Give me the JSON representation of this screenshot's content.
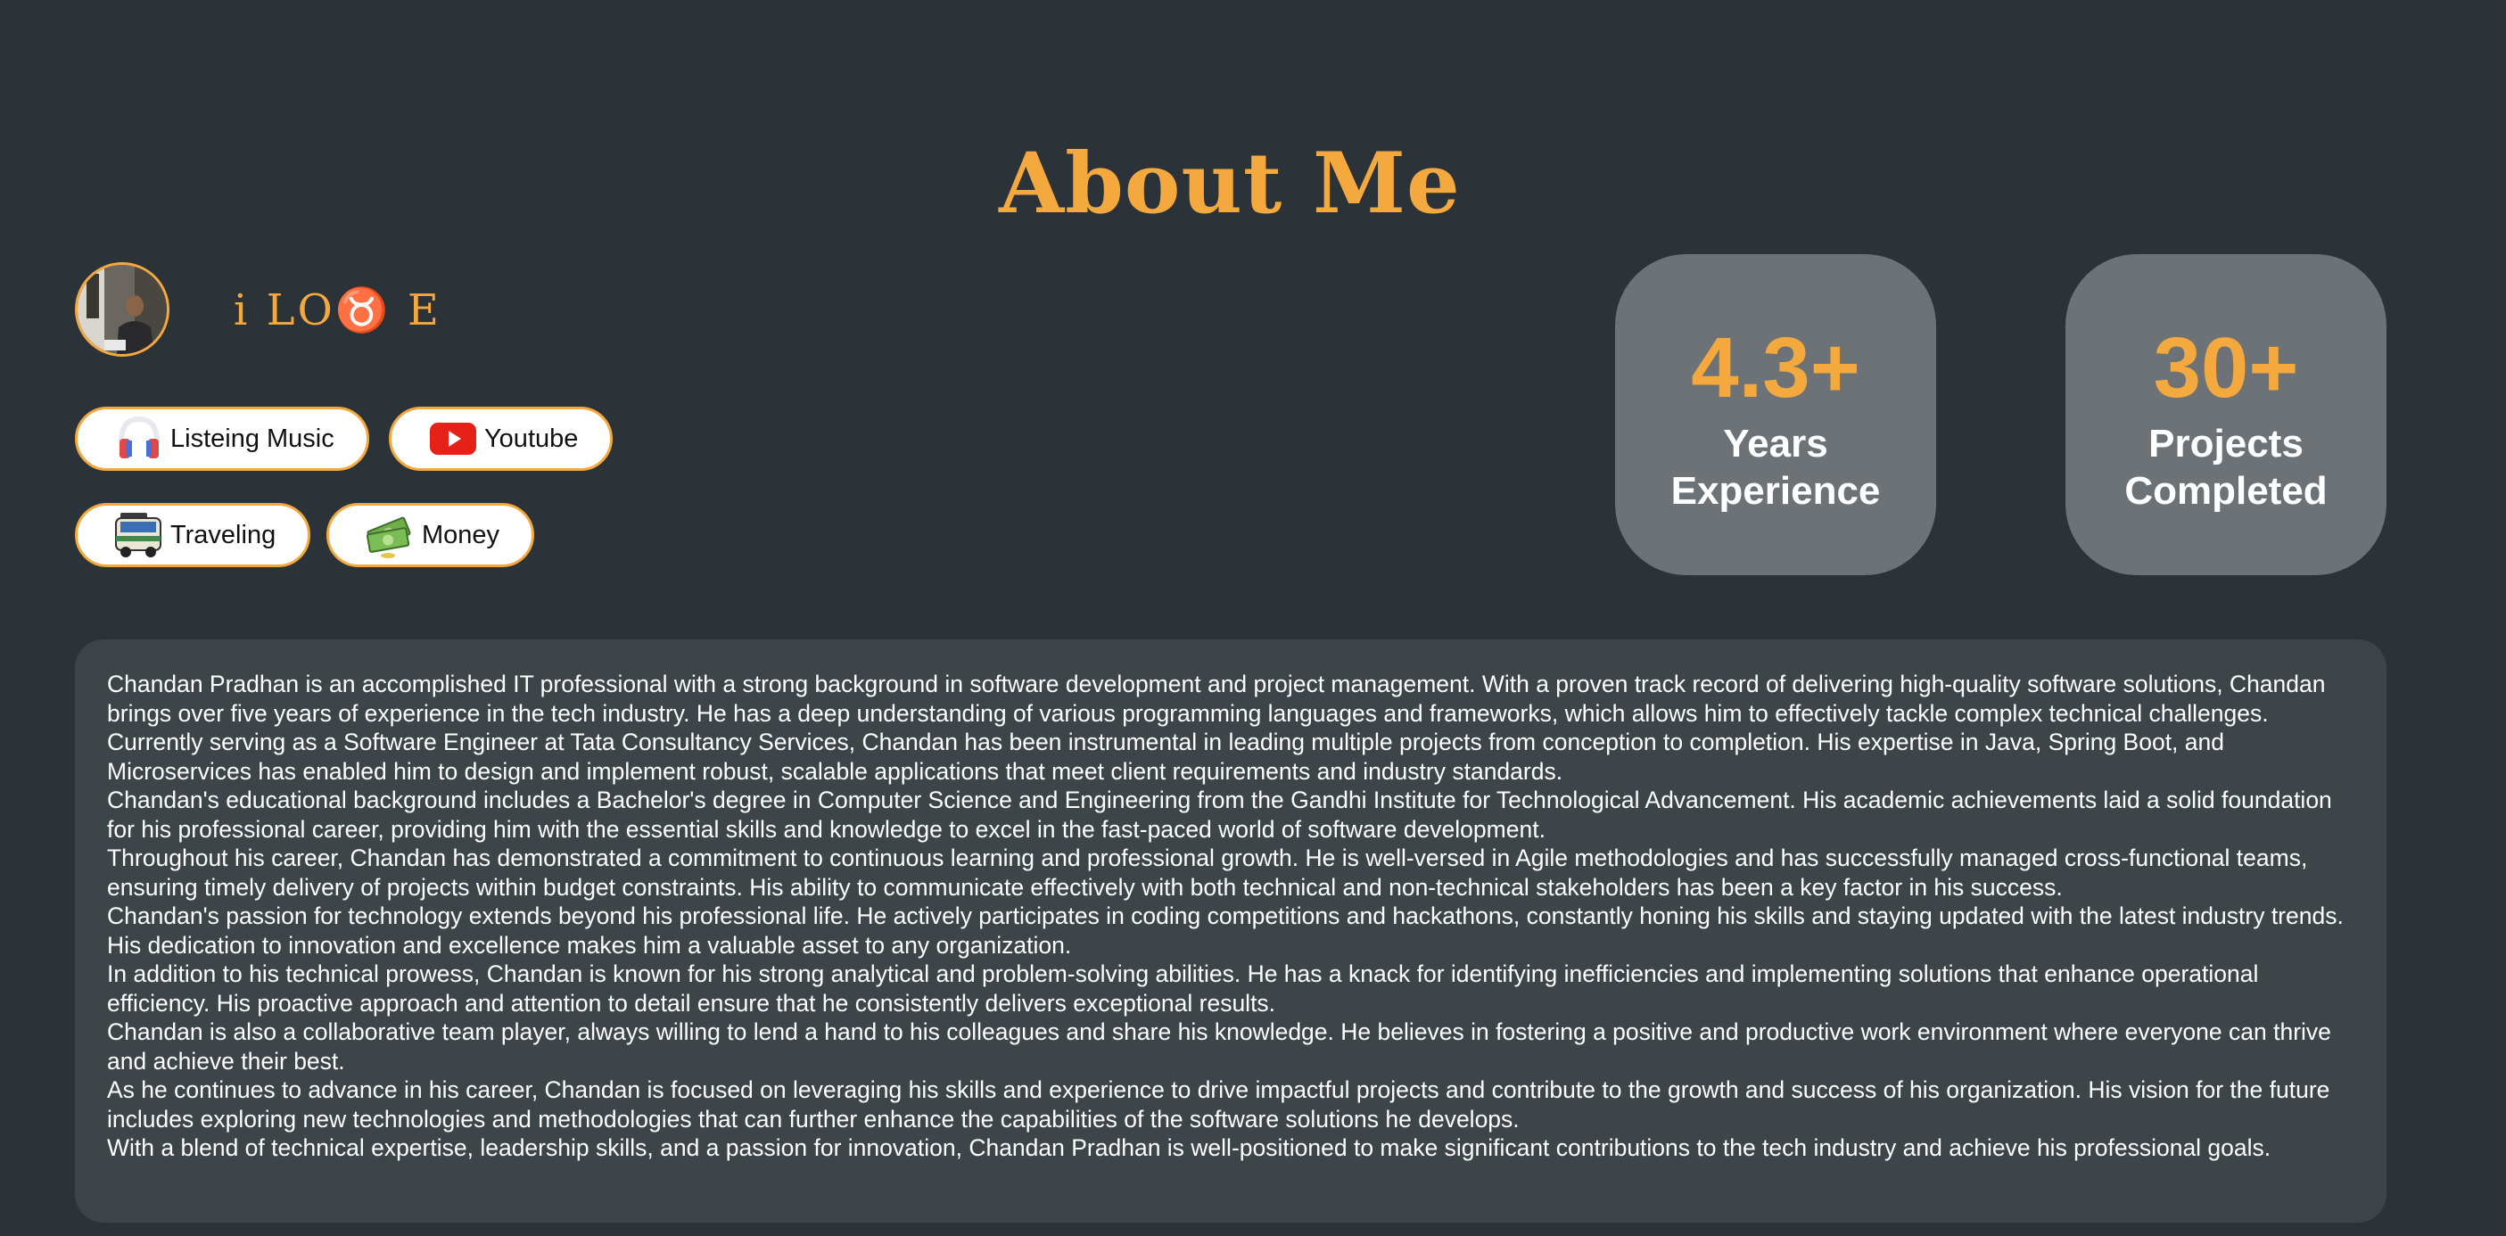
{
  "page": {
    "title": "About Me"
  },
  "profile": {
    "love_heading": "i LO♉ E"
  },
  "interests": [
    {
      "label": "Listeing Music",
      "icon": "headphones-icon"
    },
    {
      "label": "Youtube",
      "icon": "youtube-icon"
    },
    {
      "label": "Traveling",
      "icon": "bus-icon"
    },
    {
      "label": "Money",
      "icon": "money-icon"
    }
  ],
  "stats": [
    {
      "value": "4.3+",
      "label": "Years Experience"
    },
    {
      "value": "30+",
      "label": "Projects Completed"
    }
  ],
  "bio": {
    "paragraphs": [
      "Chandan Pradhan is an accomplished IT professional with a strong background in software development and project management. With a proven track record of delivering high-quality software solutions, Chandan brings over five years of experience in the tech industry. He has a deep understanding of various programming languages and frameworks, which allows him to effectively tackle complex technical challenges.",
      "Currently serving as a Software Engineer at Tata Consultancy Services, Chandan has been instrumental in leading multiple projects from conception to completion. His expertise in Java, Spring Boot, and Microservices has enabled him to design and implement robust, scalable applications that meet client requirements and industry standards.",
      "Chandan's educational background includes a Bachelor's degree in Computer Science and Engineering from the Gandhi Institute for Technological Advancement. His academic achievements laid a solid foundation for his professional career, providing him with the essential skills and knowledge to excel in the fast-paced world of software development.",
      "Throughout his career, Chandan has demonstrated a commitment to continuous learning and professional growth. He is well-versed in Agile methodologies and has successfully managed cross-functional teams, ensuring timely delivery of projects within budget constraints. His ability to communicate effectively with both technical and non-technical stakeholders has been a key factor in his success.",
      "Chandan's passion for technology extends beyond his professional life. He actively participates in coding competitions and hackathons, constantly honing his skills and staying updated with the latest industry trends. His dedication to innovation and excellence makes him a valuable asset to any organization.",
      "In addition to his technical prowess, Chandan is known for his strong analytical and problem-solving abilities. He has a knack for identifying inefficiencies and implementing solutions that enhance operational efficiency. His proactive approach and attention to detail ensure that he consistently delivers exceptional results.",
      "Chandan is also a collaborative team player, always willing to lend a hand to his colleagues and share his knowledge. He believes in fostering a positive and productive work environment where everyone can thrive and achieve their best.",
      "As he continues to advance in his career, Chandan is focused on leveraging his skills and experience to drive impactful projects and contribute to the growth and success of his organization. His vision for the future includes exploring new technologies and methodologies that can further enhance the capabilities of the software solutions he develops.",
      "With a blend of technical expertise, leadership skills, and a passion for innovation, Chandan Pradhan is well-positioned to make significant contributions to the tech industry and achieve his professional goals."
    ]
  },
  "colors": {
    "background": "#2b3238",
    "accent": "#f4a93e",
    "card": "#6c7275",
    "bio_panel": "#3d4549"
  }
}
